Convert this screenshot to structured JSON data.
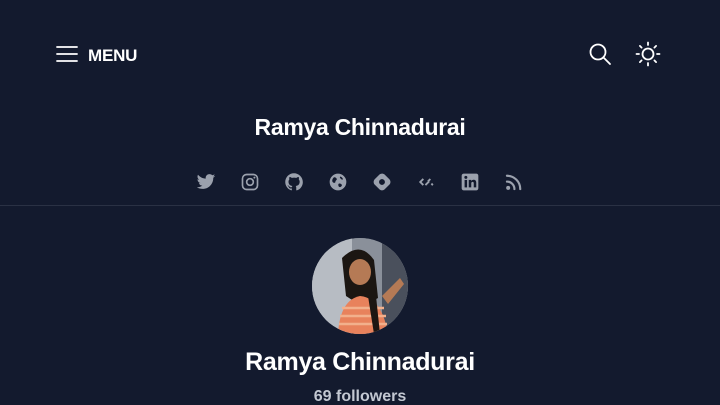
{
  "header": {
    "menu_label": "MENU",
    "blog_title": "Ramya Chinnadurai"
  },
  "icons": {
    "menu": "hamburger-icon",
    "search": "search-icon",
    "theme": "sun-icon"
  },
  "socials": [
    {
      "name": "twitter-icon"
    },
    {
      "name": "instagram-icon"
    },
    {
      "name": "github-icon"
    },
    {
      "name": "website-icon"
    },
    {
      "name": "hashnode-icon"
    },
    {
      "name": "devto-icon"
    },
    {
      "name": "linkedin-icon"
    },
    {
      "name": "rss-icon"
    }
  ],
  "profile": {
    "author_name": "Ramya Chinnadurai",
    "followers": "69 followers"
  },
  "colors": {
    "background": "#131a2e",
    "text": "#ffffff",
    "muted": "#9ba1ad",
    "divider": "#2a3144"
  }
}
